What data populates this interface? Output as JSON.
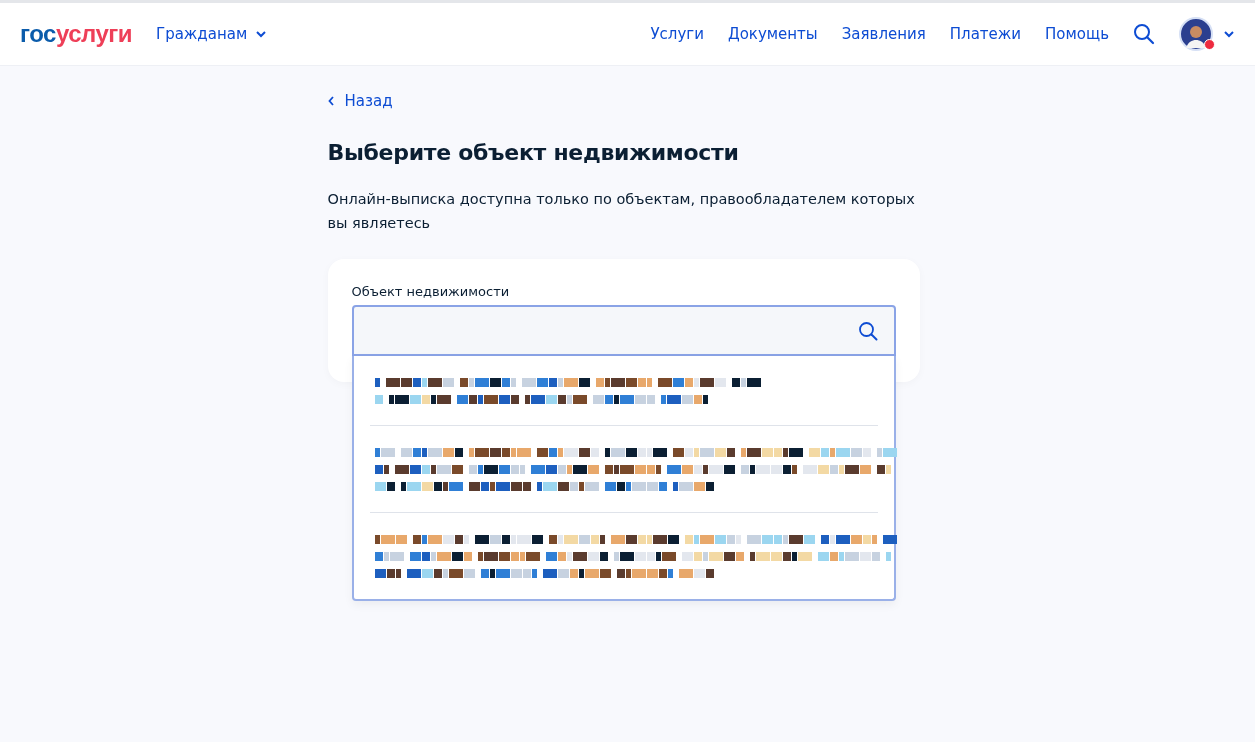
{
  "header": {
    "logo": {
      "first": "гос",
      "second": "услуги"
    },
    "audience_menu": {
      "label": "Гражданам"
    },
    "nav": [
      "Услуги",
      "Документы",
      "Заявления",
      "Платежи",
      "Помощь"
    ],
    "profile": {
      "notification": true
    }
  },
  "back_link": "Назад",
  "title": "Выберите объект недвижимости",
  "description": "Онлайн-выписка доступна только по объектам, правообладателем которых вы являетесь",
  "field": {
    "label": "Объект недвижимости",
    "expanded": true
  }
}
